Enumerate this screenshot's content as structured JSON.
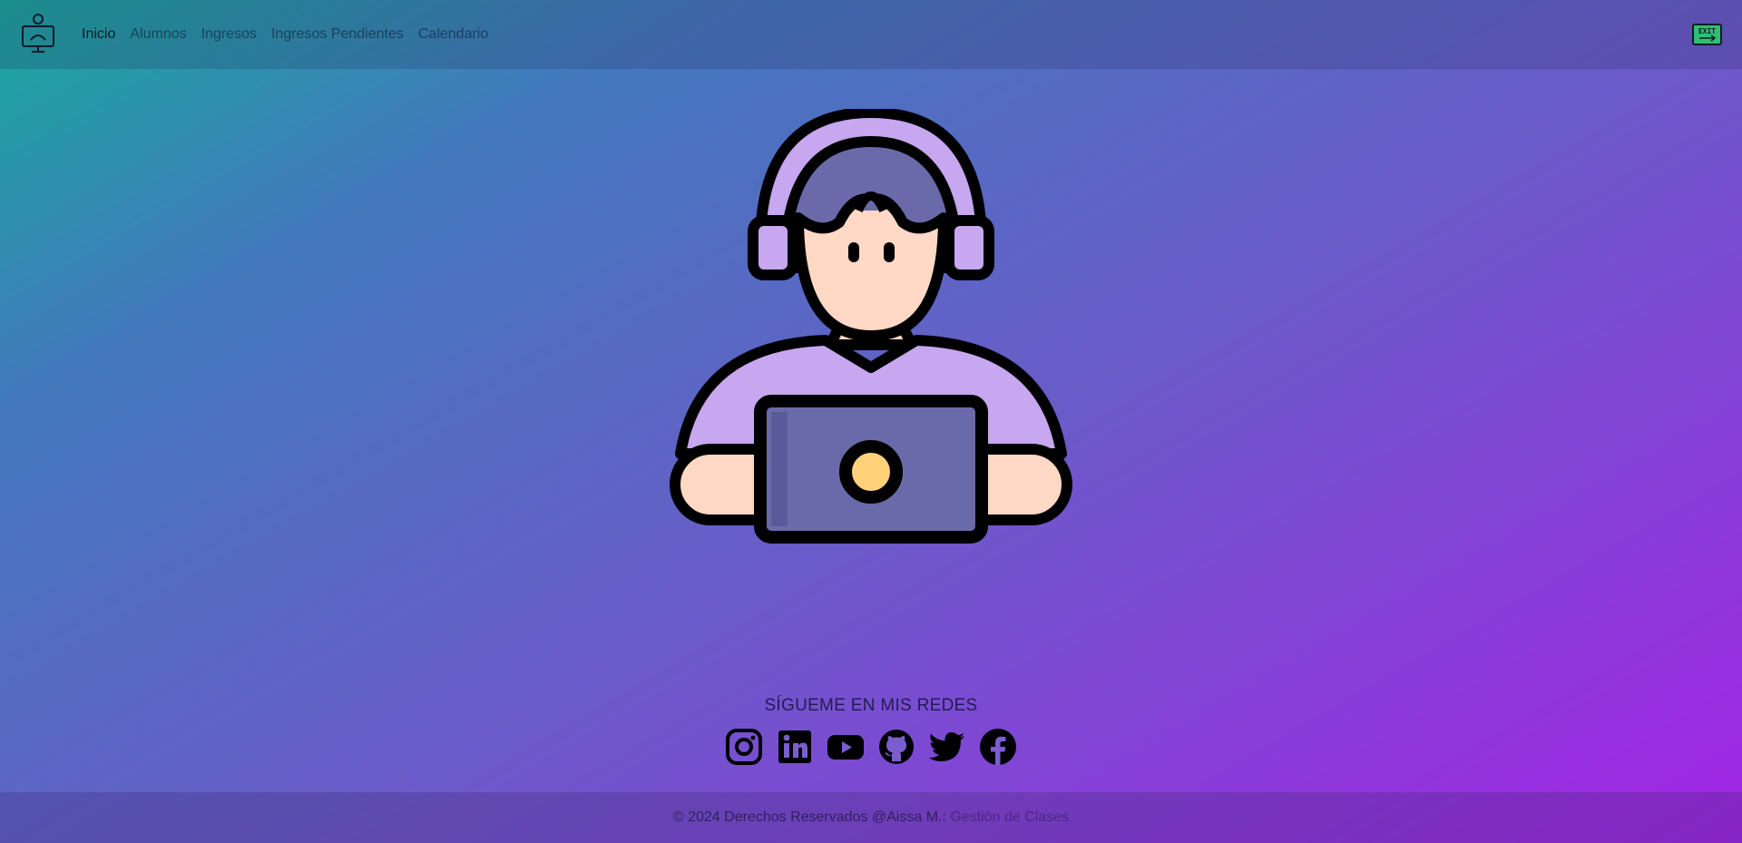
{
  "nav": {
    "brand_icon": "teacher-computer-icon",
    "links": [
      "Inicio",
      "Alumnos",
      "Ingresos",
      "Ingresos Pendientes",
      "Calendario"
    ],
    "exit_icon": "exit-sign-icon",
    "exit_label": "EXIT"
  },
  "hero": {
    "illustration": "person-with-headset-laptop"
  },
  "social": {
    "title": "SÍGUEME EN MIS REDES",
    "icons": [
      "instagram-icon",
      "linkedin-icon",
      "youtube-icon",
      "github-icon",
      "twitter-icon",
      "facebook-icon"
    ]
  },
  "footer": {
    "text": "© 2024 Derechos Reservados @Aissa M.: ",
    "link": "Gestión de Clases"
  },
  "colors": {
    "gradient_start": "#17aa9c",
    "gradient_end": "#a324e6",
    "headset": "#c7a7ef",
    "skin": "#ffd8c6",
    "laptop": "#6a6aab",
    "exit_green": "#2fbf71"
  }
}
